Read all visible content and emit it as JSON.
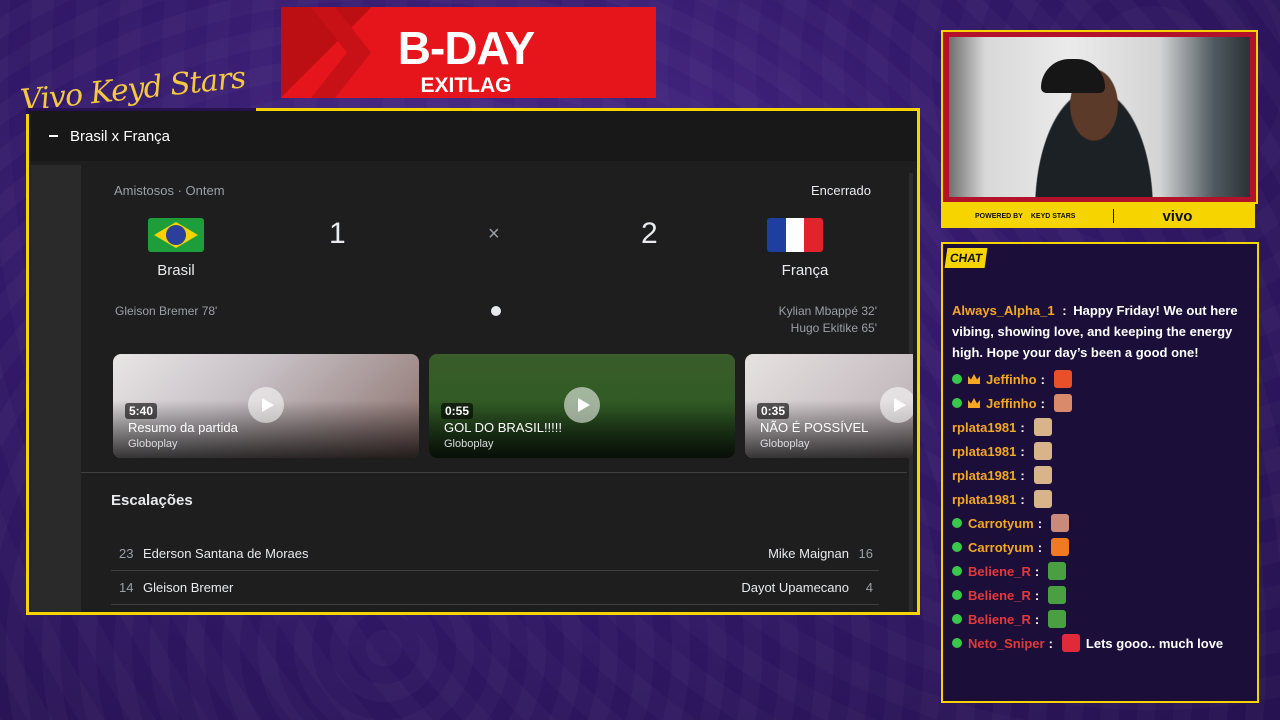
{
  "overlay": {
    "brand_script": "Vivo Keyd Stars",
    "banner_title": "B-DAY",
    "banner_sub": "EXITLAG",
    "powered_by": "POWERED BY",
    "keyd_logo": "KEYD STARS",
    "vivo": "vivo",
    "chat_tag": "CHAT",
    "accent": "#f5d400",
    "banner_color": "#e5151b"
  },
  "page": {
    "title": "Brasil x França"
  },
  "match": {
    "competition": "Amistosos",
    "when": "Ontem",
    "status": "Encerrado",
    "home_team": "Brasil",
    "away_team": "França",
    "home_score": "1",
    "away_score": "2",
    "separator": "×",
    "home_scorers": [
      "Gleison Bremer 78'"
    ],
    "away_scorers": [
      "Kylian Mbappé 32'",
      "Hugo Ekitike 65'"
    ]
  },
  "videos": [
    {
      "duration": "5:40",
      "title": "Resumo da partida",
      "source": "Globoplay"
    },
    {
      "duration": "0:55",
      "title": "GOL DO BRASIL!!!!!",
      "source": "Globoplay"
    },
    {
      "duration": "0:35",
      "title": "NÃO É POSSÍVEL",
      "source": "Globoplay"
    }
  ],
  "lineups": {
    "title": "Escalações",
    "rows": [
      {
        "home_num": "23",
        "home_name": "Ederson Santana de Moraes",
        "away_name": "Mike Maignan",
        "away_num": "16"
      },
      {
        "home_num": "14",
        "home_name": "Gleison Bremer",
        "away_name": "Dayot Upamecano",
        "away_num": "4"
      }
    ]
  },
  "chat": {
    "first_message": {
      "user": "Always_Alpha_1",
      "text": "Happy Friday! We out here vibing, showing love, and keeping the energy high. Hope your day’s been a good one!"
    },
    "messages": [
      {
        "user": "Jeffinho",
        "badge": "crown",
        "color": "orange",
        "emote": "#e8502a"
      },
      {
        "user": "Jeffinho",
        "badge": "crown",
        "color": "orange",
        "emote": "#d98a6a"
      },
      {
        "user": "rplata1981",
        "badge": "",
        "color": "orange",
        "emote": "#d7b48a"
      },
      {
        "user": "rplata1981",
        "badge": "",
        "color": "orange",
        "emote": "#d7b48a"
      },
      {
        "user": "rplata1981",
        "badge": "",
        "color": "orange",
        "emote": "#d7b48a"
      },
      {
        "user": "rplata1981",
        "badge": "",
        "color": "orange",
        "emote": "#d7b48a"
      },
      {
        "user": "Carrotyum",
        "badge": "dot",
        "color": "orange",
        "emote": "#c98a7a"
      },
      {
        "user": "Carrotyum",
        "badge": "dot",
        "color": "orange",
        "emote": "#f07a22"
      },
      {
        "user": "Beliene_R",
        "badge": "dot",
        "color": "red",
        "emote": "#4aa040"
      },
      {
        "user": "Beliene_R",
        "badge": "dot",
        "color": "red",
        "emote": "#4aa040"
      },
      {
        "user": "Beliene_R",
        "badge": "dot",
        "color": "red",
        "emote": "#4aa040"
      },
      {
        "user": "Neto_Sniper",
        "badge": "dot",
        "color": "red",
        "emote": "#e02a3a",
        "text": "Lets gooo.. much love"
      }
    ]
  }
}
